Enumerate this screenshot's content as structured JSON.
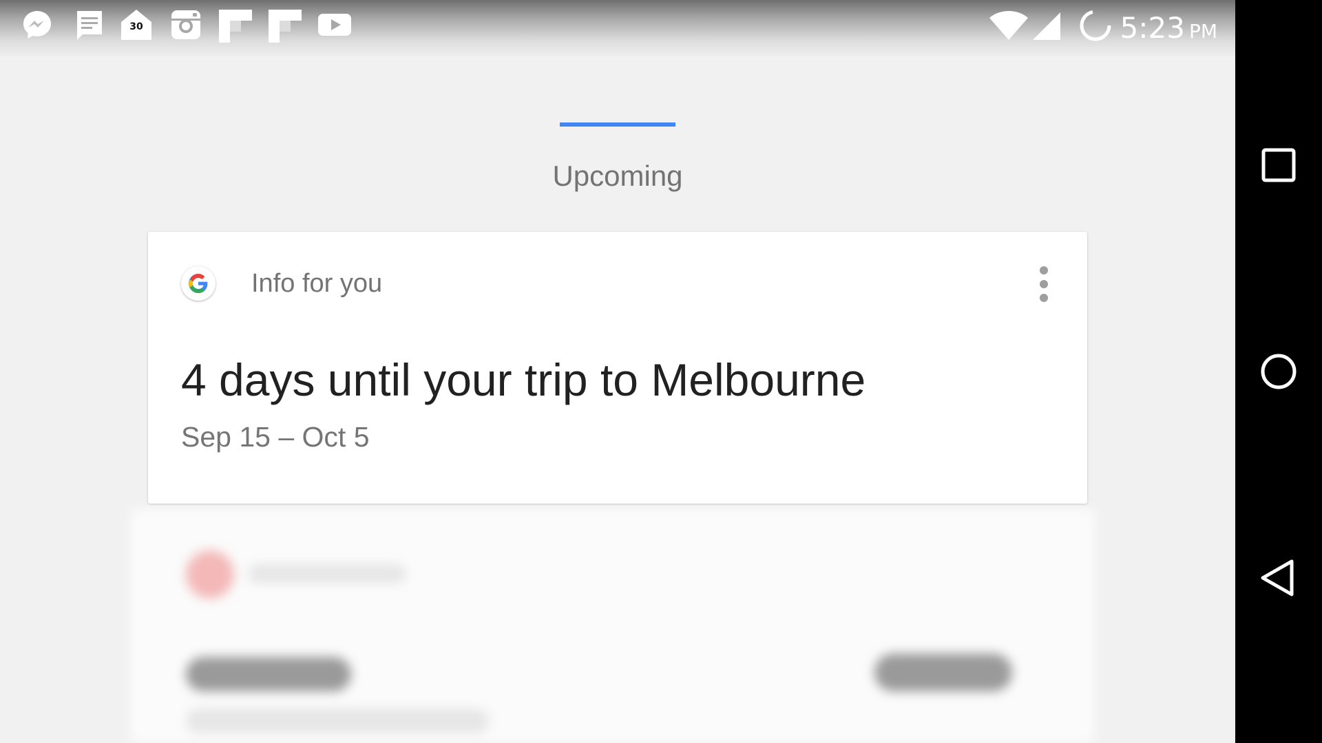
{
  "status_bar": {
    "notification_icons": [
      "messenger-icon",
      "messages-icon",
      "calendar-badge-icon",
      "instagram-icon",
      "flipboard-icon",
      "flipboard-icon",
      "youtube-icon"
    ],
    "badge_number": "30",
    "system_icons": [
      "wifi-icon",
      "cell-signal-icon",
      "sync-icon"
    ],
    "time": "5:23",
    "ampm": "PM"
  },
  "header": {
    "title": "Upcoming",
    "accent_color": "#4285f4"
  },
  "card": {
    "source_label": "Info for you",
    "logo": "google-g-logo",
    "title": "4 days until your trip to Melbourne",
    "subtitle": "Sep 15 – Oct 5",
    "menu_icon": "more-vert-icon"
  },
  "nav_bar": {
    "buttons": [
      "recents-icon",
      "home-icon",
      "back-icon"
    ]
  }
}
